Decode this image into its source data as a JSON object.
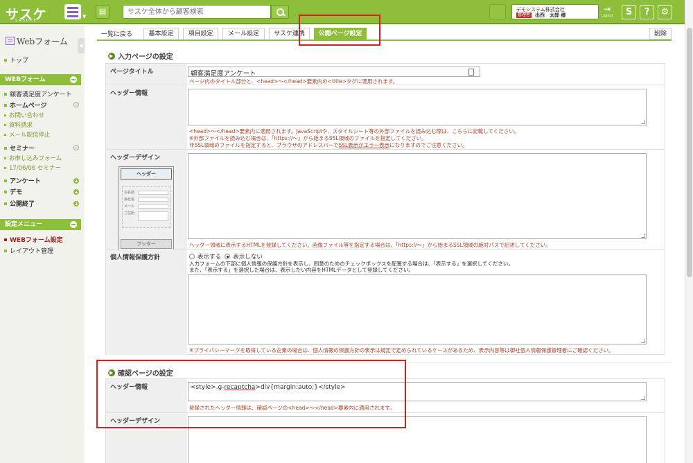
{
  "app": {
    "logo": "サスケ",
    "logo_sub": "SASUKE",
    "search_placeholder": "サスケ全体から顧客検索",
    "user": {
      "company": "デモシステム株式会社",
      "badge": "管理者",
      "name": "出西　太郎 様"
    },
    "logout_label": "Logout",
    "buttons": {
      "s": "S",
      "help": "?",
      "settings": "⚙"
    }
  },
  "sidebar": {
    "title": "Webフォーム",
    "top": "トップ",
    "webform_head": "WEBフォーム",
    "items": {
      "survey": "顧客満足度アンケート",
      "homepage": "ホームページ",
      "contact": "お問い合わせ",
      "request": "資料請求",
      "mail_stop": "メール配信停止",
      "seminar": "セミナー",
      "apply": "お申し込みフォーム",
      "seminar_0606": "17/06/06 セミナー",
      "questionnaire": "アンケート",
      "demo": "デモ",
      "closed": "公開終了"
    },
    "settings_head": "設定メニュー",
    "settings_items": {
      "webform_settings": "WEBフォーム設定",
      "layout": "レイアウト管理"
    }
  },
  "tabs": {
    "back": "一覧に戻る",
    "basic": "基本設定",
    "items": "項目設定",
    "mail": "メール設定",
    "sasuke_link": "サスケ連携",
    "public": "公開ページ設定",
    "delete": "削除"
  },
  "input_page": {
    "title": "入力ページの設定",
    "page_title": {
      "label": "ページタイトル",
      "value": "顧客満足度アンケート",
      "note": "ページ内のタイトル部分と、<head>～</head>要素内の<title>タグに適用されます。"
    },
    "header_info": {
      "label": "ヘッダー情報",
      "note1": "<head>～</head>要素内に適用されます。JavaScriptや、スタイルシート等の外部ファイルを読み込む際は、こちらに記載してください。",
      "note2": "※外部ファイルを読み込む場合は、「https://～」から始まるSSL領域のファイルを指定してください。",
      "note3a": "非SSL領域のファイルを指定すると、ブラウザのアドレスバーで",
      "note3b": "SSL表示がエラー表示",
      "note3c": "になりますのでご注意ください。"
    },
    "header_design": {
      "label": "ヘッダーデザイン",
      "thumb_header": "ヘッダー",
      "thumb_footer": "フッター",
      "thumb_fields": [
        "お名前",
        "会社名",
        "メール",
        "ご住所"
      ],
      "note": "ヘッダー領域に表示するHTMLを登録してください。画像ファイル等を指定する場合は、「https://～」から始まるSSL領域の絶対パスで記述してください。"
    },
    "privacy": {
      "label": "個人情報保護方針",
      "opt_show": "表示する",
      "opt_hide": "表示しない",
      "selected": "表示しない",
      "desc1": "入力フォームの下部に個人情報の保護方針を表示し、同意のためのチェックボックスを配置する場合は、「表示する」を選択してください。",
      "desc2": "また、「表示する」を選択した場合は、表示したい内容をHTMLデータとして登録してください。",
      "note": "※プライバシーマークを取得している企業の場合は、個人情報の保護方針の表示は規定で定められているケースがあるため、表示内容等は御社個人情報保護管理者にご確認ください。"
    }
  },
  "confirm_page": {
    "title": "確認ページの設定",
    "header_info": {
      "label": "ヘッダー情報",
      "value_a": "<style>.g-",
      "value_b": "recaptcha",
      "value_c": ">div{margin:auto;}</style>",
      "note": "登録されたヘッダー情報は、確認ページの<head>～</head>要素内に適用されます。"
    },
    "header_design": {
      "label": "ヘッダーデザイン"
    }
  },
  "colors": {
    "brand": "#8dbf3a",
    "note": "#a8452a",
    "highlight": "#e01b1b",
    "active_menu": "#a8201a"
  }
}
